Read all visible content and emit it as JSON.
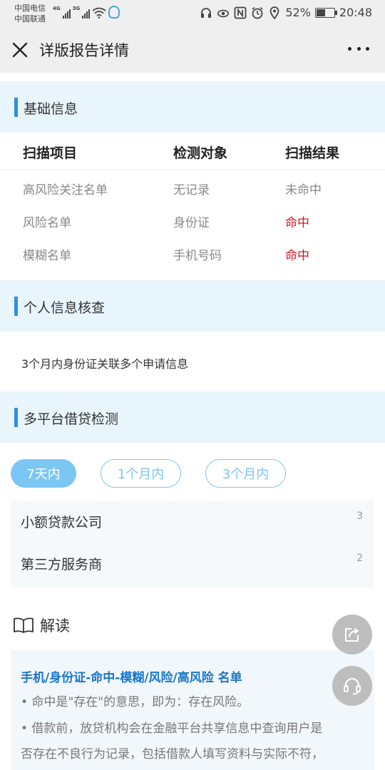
{
  "status_bar": {
    "carrier_1": "中国电信",
    "carrier_2": "中国联通",
    "net_1": "4G",
    "net_2": "3G",
    "battery_percent": "52%",
    "battery_level": 0.52,
    "time": "20:48",
    "icons": [
      "headphones-icon",
      "eye-icon",
      "nfc-icon",
      "alarm-icon",
      "location-icon",
      "battery-icon"
    ]
  },
  "header": {
    "title": "详版报告详情",
    "close_icon": "close-icon",
    "more_icon": "more-icon"
  },
  "sections": {
    "basic": "基础信息",
    "personal": "个人信息核查",
    "multi_platform": "多平台借贷检测"
  },
  "scan_table": {
    "headers": [
      "扫描项目",
      "检测对象",
      "扫描结果"
    ],
    "rows": [
      {
        "item": "高风险关注名单",
        "target": "无记录",
        "result": "未命中"
      },
      {
        "item": "风险名单",
        "target": "身份证",
        "result": "命中"
      },
      {
        "item": "模糊名单",
        "target": "手机号码",
        "result": "命中"
      }
    ]
  },
  "personal_check": {
    "text": "3个月内身份证关联多个申请信息"
  },
  "tabs": [
    {
      "label": "7天内",
      "active": true
    },
    {
      "label": "1个月内",
      "active": false
    },
    {
      "label": "3个月内",
      "active": false
    }
  ],
  "platforms": [
    {
      "name": "小额贷款公司",
      "count": "3"
    },
    {
      "name": "第三方服务商",
      "count": "2"
    }
  ],
  "interpretation": {
    "title": "解读",
    "heading": "手机/身份证-命中-模糊/风险/高风险 名单",
    "lines": [
      "• 命中是\"存在\"的意思，即为：存在风险。",
      "• 借款前，放贷机构会在金融平台共享信息中查询用户是",
      "否存在不良行为记录，包括借款人填写资料与实际不符，"
    ]
  },
  "colors": {
    "accent": "#2d8fe0",
    "tab": "#7cc6f4",
    "hit": "#d9161c",
    "heading_link": "#1976c8",
    "section_bg": "#e9f5fc"
  }
}
